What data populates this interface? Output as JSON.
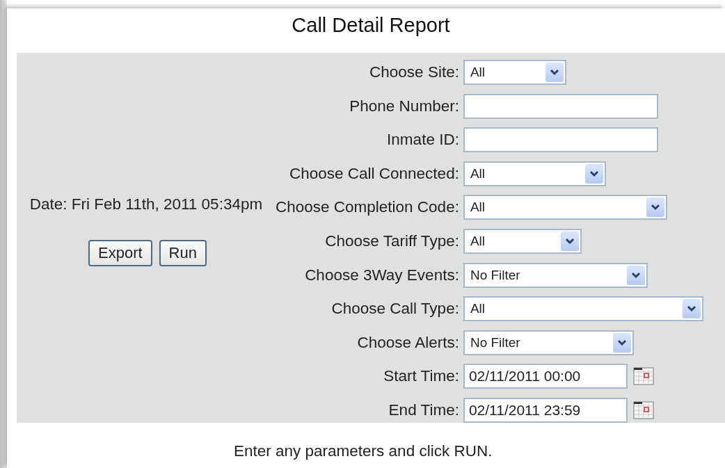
{
  "title": "Call Detail Report",
  "date_label": "Date: Fri Feb 11th, 2011 05:34pm",
  "buttons": [
    "Export",
    "Run"
  ],
  "fields": [
    {
      "label": "Choose Site:",
      "kind": "select",
      "value": "All"
    },
    {
      "label": "Phone Number:",
      "kind": "text"
    },
    {
      "label": "Inmate ID:",
      "kind": "text"
    },
    {
      "label": "Choose Call Connected:",
      "kind": "select",
      "value": "All"
    },
    {
      "label": "Choose Completion Code:",
      "kind": "select",
      "value": "All"
    },
    {
      "label": "Choose Tariff Type:",
      "kind": "select",
      "value": "All"
    },
    {
      "label": "Choose 3Way Events:",
      "kind": "select",
      "value": "No Filter"
    },
    {
      "label": "Choose Call Type:",
      "kind": "select",
      "value": "All"
    },
    {
      "label": "Choose Alerts:",
      "kind": "select",
      "value": "No Filter"
    },
    {
      "label": "Start Time:",
      "kind": "date",
      "value": "02/11/2011 00:00"
    },
    {
      "label": "End Time:",
      "kind": "date",
      "value": "02/11/2011 23:59"
    }
  ],
  "footer": "Enter any parameters and click RUN."
}
